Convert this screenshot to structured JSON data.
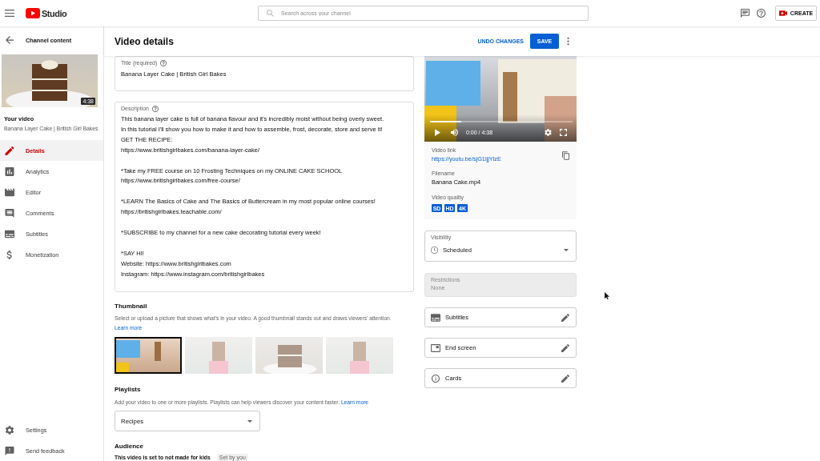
{
  "top_bar": {
    "logo_text": "Studio",
    "search": {
      "placeholder": "Search across your channel"
    },
    "create_button": "CREATE"
  },
  "sidebar": {
    "back_label": "Channel content",
    "video": {
      "duration": "4:38",
      "heading": "Your video",
      "title": "Banana Layer Cake | British Girl Bakes"
    },
    "items": [
      {
        "kind": "details",
        "label": "Details",
        "selected": true
      },
      {
        "kind": "analytics",
        "label": "Analytics",
        "selected": false
      },
      {
        "kind": "editor",
        "label": "Editor",
        "selected": false
      },
      {
        "kind": "comments",
        "label": "Comments",
        "selected": false
      },
      {
        "kind": "subtitles",
        "label": "Subtitles",
        "selected": false
      },
      {
        "kind": "monetization",
        "label": "Monetization",
        "selected": false
      }
    ],
    "footer_items": [
      {
        "kind": "settings",
        "label": "Settings"
      },
      {
        "kind": "feedback",
        "label": "Send feedback"
      }
    ]
  },
  "header": {
    "title": "Video details",
    "undo_button": "UNDO CHANGES",
    "save_button": "SAVE"
  },
  "title_field": {
    "label": "Title (required)",
    "value": "Banana Layer Cake | British Girl Bakes"
  },
  "description_field": {
    "label": "Description",
    "paragraphs": [
      [
        "This banana layer cake is full of banana flavour and it's incredibly moist without being overly sweet.",
        "In this tutorial I'll show you how to make it and how to assemble, frost, decorate, store and serve it!",
        "GET THE RECIPE:",
        "https://www.britishgirlbakes.com/banana-layer-cake/"
      ],
      [
        "*Take my FREE course on 10 Frosting Techniques on my ONLINE CAKE SCHOOL",
        "https://www.britishgirlbakes.com/free-course/"
      ],
      [
        "*LEARN The Basics of Cake and The Basics of Buttercream in my most popular online courses!",
        "https://britishgirlbakes.teachable.com/"
      ],
      [
        "*SUBSCRIBE to my channel for a new cake decorating tutorial every week!"
      ],
      [
        "*SAY HI!",
        "Website: https://www.britishgirlbakes.com",
        "Instagram: https://www.instagram.com/britishgirlbakes"
      ]
    ]
  },
  "thumbnail_section": {
    "heading": "Thumbnail",
    "text": "Select or upload a picture that shows what's in your video. A good thumbnail stands out and draws viewers' attention.",
    "link": "Learn more",
    "thumbnails": [
      {
        "selected": true
      },
      {
        "selected": false
      },
      {
        "selected": false
      },
      {
        "selected": false
      }
    ]
  },
  "playlists": {
    "heading": "Playlists",
    "text": "Add your video to one or more playlists. Playlists can help viewers discover your content faster.",
    "link": "Learn more",
    "dropdown": "Recipes"
  },
  "audience": {
    "heading": "Audience",
    "text": "This video is set to not made for kids",
    "chip": "Set by you"
  },
  "player": {
    "time": "0:00 / 4:38",
    "level": 0.22
  },
  "video_info": {
    "link_label": "Video link",
    "link": "https://youtu.be/sjG1ljjYlzE",
    "filename_label": "Filename",
    "filename": "Banana Cake.mp4",
    "quality_label": "Video quality",
    "qualities": [
      "SD",
      "HD",
      "4K"
    ]
  },
  "visibility": {
    "label": "Visibility",
    "value": "Scheduled"
  },
  "restrictions": {
    "label": "Restrictions",
    "value": "None",
    "disabled": true
  },
  "extras": [
    {
      "kind": "subtitles",
      "label": "Subtitles"
    },
    {
      "kind": "end_screen",
      "label": "End screen"
    },
    {
      "kind": "cards",
      "label": "Cards"
    }
  ]
}
